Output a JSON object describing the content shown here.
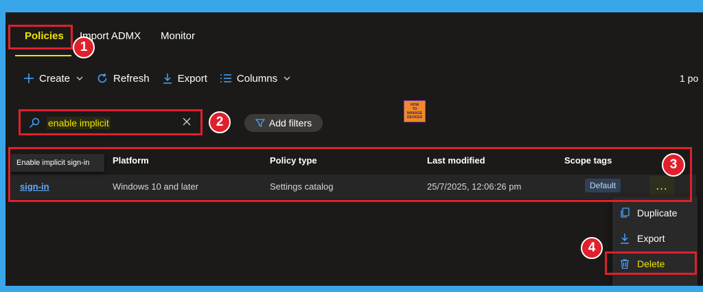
{
  "tabs": [
    {
      "label": "Policies"
    },
    {
      "label": "Import ADMX"
    },
    {
      "label": "Monitor"
    }
  ],
  "toolbar": {
    "create_label": "Create",
    "refresh_label": "Refresh",
    "export_label": "Export",
    "columns_label": "Columns",
    "page_count": "1 po"
  },
  "search": {
    "value": "enable implicit",
    "icon": "search-icon"
  },
  "filters": {
    "add_label": "Add filters"
  },
  "table": {
    "headers": [
      "Platform",
      "Policy type",
      "Last modified",
      "Scope tags"
    ],
    "tooltip": "Enable implicit sign-in",
    "row": {
      "name_link": "sign-in",
      "platform": "Windows 10 and later",
      "policy_type": "Settings catalog",
      "last_modified": "25/7/2025, 12:06:26 pm",
      "scope_tag": "Default",
      "more": "…"
    }
  },
  "context_menu": {
    "duplicate_label": "Duplicate",
    "export_label": "Export",
    "delete_label": "Delete"
  },
  "callouts": [
    "1",
    "2",
    "3",
    "4"
  ],
  "logo": {
    "lines": [
      "HOW",
      "TO",
      "MANAGE",
      "DEVICES"
    ]
  },
  "colors": {
    "accent_yellow": "#f2e600",
    "callout_red": "#e0202c",
    "link_blue": "#62a8ff",
    "background": "#1b1a19",
    "outer_border": "#3aa6ea"
  }
}
